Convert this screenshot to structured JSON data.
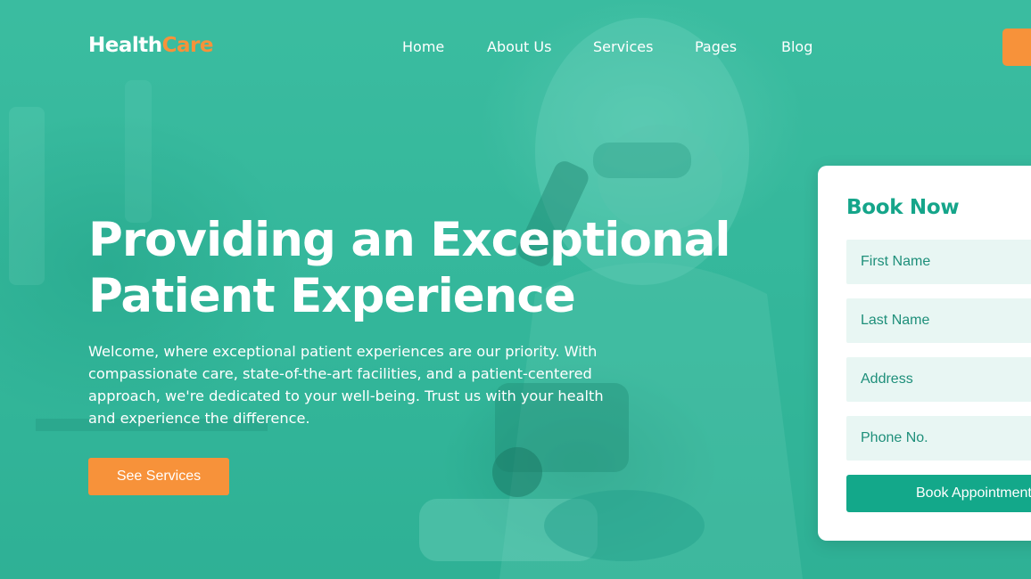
{
  "brand": {
    "part1": "Health",
    "part2": "Care"
  },
  "nav": {
    "items": [
      {
        "label": "Home"
      },
      {
        "label": "About Us"
      },
      {
        "label": "Services"
      },
      {
        "label": "Pages"
      },
      {
        "label": "Blog"
      }
    ]
  },
  "hero": {
    "title": "Providing an Exceptional Patient Experience",
    "text": "Welcome, where exceptional patient experiences are our priority. With compassionate care, state-of-the-art facilities, and a patient-centered approach, we're dedicated to your well-being. Trust us with your health and experience the difference.",
    "cta_label": "See Services"
  },
  "booking": {
    "title": "Book Now",
    "fields": [
      {
        "placeholder": "First Name"
      },
      {
        "placeholder": "Last Name"
      },
      {
        "placeholder": "Address"
      },
      {
        "placeholder": "Phone No."
      }
    ],
    "submit_label": "Book Appointment"
  },
  "colors": {
    "primary": "#15a58a",
    "accent": "#f7923a",
    "field_bg": "#e8f6f3",
    "hero_tint": "#3fbfa3"
  }
}
